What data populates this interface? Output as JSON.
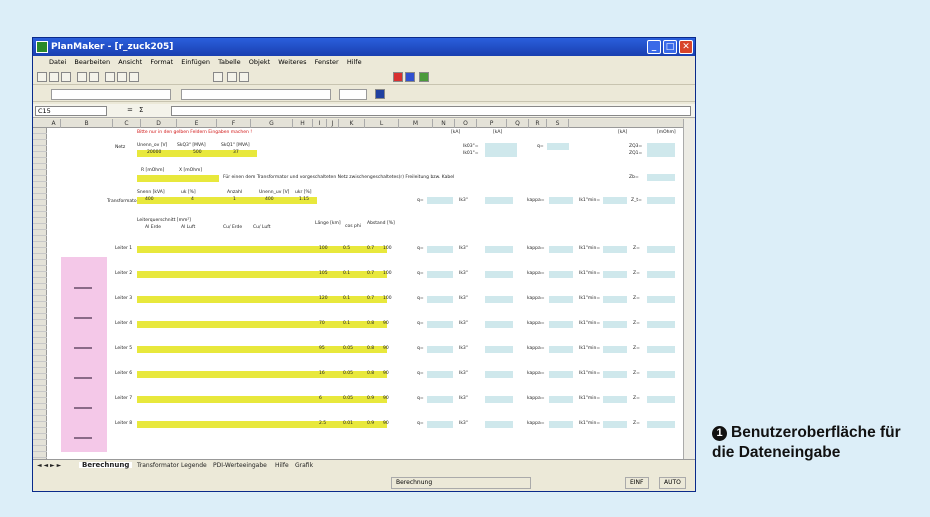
{
  "window": {
    "title": "PlanMaker - [r_zuck205]",
    "controls": {
      "minimize": "_",
      "maximize": "□",
      "close": "✕"
    }
  },
  "menu": [
    "Datei",
    "Bearbeiten",
    "Ansicht",
    "Format",
    "Einfügen",
    "Tabelle",
    "Objekt",
    "Weiteres",
    "Fenster",
    "Hilfe"
  ],
  "formula_bar": {
    "cell_ref": "C15",
    "sigma": "Σ",
    "equals": "="
  },
  "sheet": {
    "columns": [
      "A",
      "B",
      "C",
      "D",
      "E",
      "F",
      "G",
      "H",
      "I",
      "J",
      "K",
      "L",
      "M",
      "N",
      "O",
      "P",
      "Q",
      "R",
      "S"
    ],
    "instruction": "Bitte nur in den gelben Feldern Eingaben machen !",
    "netz_label": "Netz",
    "unenn_ov": "Unenn_ov [V]",
    "sk03": "SkQ3\" [MVA]",
    "sk01": "SkQ1\" [MVA]",
    "unenn_val": "20000",
    "sk03_val": "500",
    "sk01_val": "37",
    "rb": "R [mOhm]",
    "xb": "X [mOhm]",
    "note": "Für einen dem Transformator und vorgeschalteten Netz zwischengeschaltetes(r) Freileitung bzw. Kabel",
    "snenn": "Snenn [kVA]",
    "uk": "uk [%]",
    "anzahl": "Anzahl",
    "unenn_uv": "Unenn_uv [V]",
    "ukr": "ukr [%]",
    "snenn_val": "400",
    "uk_val": "4",
    "anzahl_val": "1",
    "unenn_uv_val": "400",
    "ukr_val": "1.15",
    "trafo_label": "Transformator",
    "leiter_hdr": "Leiterquerschnitt [mm²]",
    "al_erde": "Al Erde",
    "al_luft": "Al Luft",
    "cu_erde": "Cu/ Erde",
    "cu_luft": "Cu/ Luft",
    "laenge": "Länge [km]",
    "cosphi": "cos phi",
    "abstand": "Abstand [%]",
    "k3_label": "Ik3\"",
    "kappa_label": "kappa=",
    "k1_label": "Ik1\"min=",
    "z_label": "Z=",
    "ka": "[kA]",
    "mohm": "[mOhm]",
    "ik03": "Ik03\"=",
    "ik01": "Ik01\"=",
    "zq03": "ZQ3=",
    "zq01": "ZQ1=",
    "q": "q=",
    "zb": "Zb=",
    "zt": "Z_t=",
    "leiter_rows": [
      {
        "label": "Leiter 1",
        "len": "100",
        "c1": "0.5",
        "c2": "0.7",
        "c3": "100"
      },
      {
        "label": "Leiter 2",
        "len": "105",
        "c1": "0.1",
        "c2": "0.7",
        "c3": "100"
      },
      {
        "label": "Leiter 3",
        "len": "120",
        "c1": "0.1",
        "c2": "0.7",
        "c3": "100"
      },
      {
        "label": "Leiter 4",
        "len": "70",
        "c1": "0.1",
        "c2": "0.8",
        "c3": "90"
      },
      {
        "label": "Leiter 5",
        "len": "95",
        "c1": "0.05",
        "c2": "0.8",
        "c3": "90"
      },
      {
        "label": "Leiter 6",
        "len": "16",
        "c1": "0.05",
        "c2": "0.8",
        "c3": "90"
      },
      {
        "label": "Leiter 7",
        "len": "6",
        "c1": "0.05",
        "c2": "0.9",
        "c3": "90"
      },
      {
        "label": "Leiter 8",
        "len": "2.5",
        "c1": "0.01",
        "c2": "0.9",
        "c3": "90"
      }
    ]
  },
  "tabs": [
    "Berechnung",
    "Transformator",
    "Legende",
    "PDI-Werteeingabe",
    "Hilfe",
    "Grafik"
  ],
  "status": {
    "sheet": "Berechnung",
    "mode": "EINF",
    "auto": "AUTO"
  },
  "caption": {
    "number": "1",
    "text": "Benutzeroberfläche für die Dateneingabe"
  }
}
